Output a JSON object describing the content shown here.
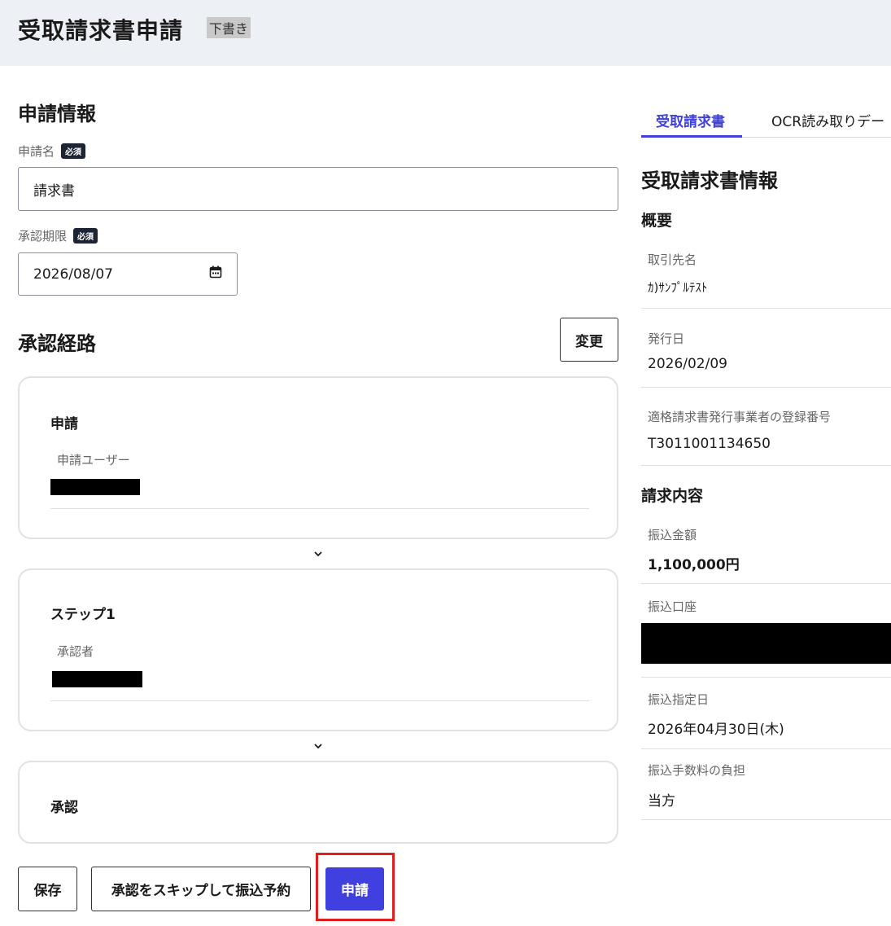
{
  "header": {
    "title": "受取請求書申請",
    "status": "下書き"
  },
  "form": {
    "section_title": "申請情報",
    "name_label": "申請名",
    "required_label": "必須",
    "name_value": "請求書",
    "deadline_label": "承認期限",
    "deadline_value": "2026/08/07"
  },
  "route": {
    "section_title": "承認経路",
    "change_button": "変更",
    "steps": [
      {
        "title": "申請",
        "sublabel": "申請ユーザー"
      },
      {
        "title": "ステップ1",
        "sublabel": "承認者"
      },
      {
        "title": "承認"
      }
    ]
  },
  "actions": {
    "save": "保存",
    "skip": "承認をスキップして振込予約",
    "submit": "申請"
  },
  "panel": {
    "tabs": [
      "受取請求書",
      "OCR読み取りデー"
    ],
    "title": "受取請求書情報",
    "overview_title": "概要",
    "overview": [
      {
        "label": "取引先名",
        "value": "ｶ)ｻﾝﾌﾟﾙﾃｽﾄ"
      },
      {
        "label": "発行日",
        "value": "2026/02/09"
      },
      {
        "label": "適格請求書発行事業者の登録番号",
        "value": "T3011001134650"
      }
    ],
    "billing_title": "請求内容",
    "billing": [
      {
        "label": "振込金額",
        "value": "1,100,000円"
      },
      {
        "label": "振込口座",
        "value": ""
      },
      {
        "label": "振込指定日",
        "value": "2026年04月30日(木)"
      },
      {
        "label": "振込手数料の負担",
        "value": "当方"
      }
    ]
  }
}
